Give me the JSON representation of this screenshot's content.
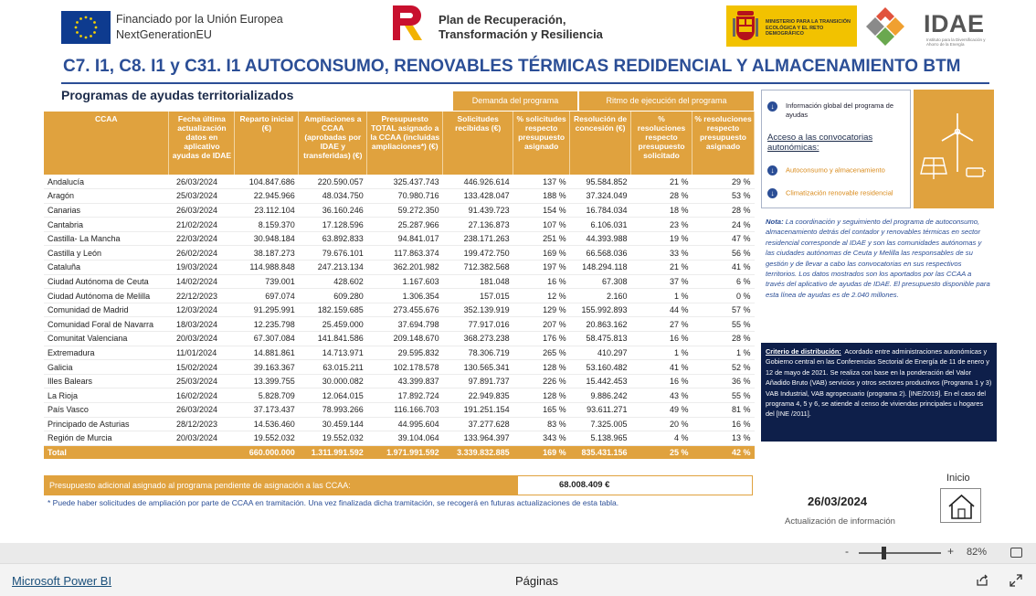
{
  "header": {
    "eu_line1": "Financiado por la Unión Europea",
    "eu_line2": "NextGenerationEU",
    "prtr_line1": "Plan de Recuperación,",
    "prtr_line2": "Transformación y Resiliencia",
    "ministerio": "MINISTERIO PARA LA TRANSICIÓN ECOLÓGICA Y EL RETO DEMOGRÁFICO",
    "idae": "IDAE",
    "idae_sub": "Instituto para la Diversificación y Ahorro de la Energía"
  },
  "title": "C7. I1, C8. I1 y C31. I1 AUTOCONSUMO, RENOVABLES TÉRMICAS REDIDENCIAL Y ALMACENAMIENTO BTM",
  "subtitle": "Programas de ayudas territorializados",
  "table": {
    "group_demanda": "Demanda del programa",
    "group_ritmo": "Ritmo de ejecución del programa",
    "columns": [
      "CCAA",
      "Fecha última actualización datos en aplicativo ayudas de IDAE",
      "Reparto inicial (€)",
      "Ampliaciones a CCAA (aprobadas por IDAE y transferidas) (€)",
      "Presupuesto TOTAL asignado a la CCAA (incluidas ampliaciones*) (€)",
      "Solicitudes recibidas (€)",
      "% solicitudes respecto presupuesto asignado",
      "Resolución de concesión (€)",
      "% resoluciones respecto presupuesto solicitado",
      "% resoluciones respecto presupuesto asignado"
    ],
    "rows": [
      [
        "Andalucía",
        "26/03/2024",
        "104.847.686",
        "220.590.057",
        "325.437.743",
        "446.926.614",
        "137 %",
        "95.584.852",
        "21 %",
        "29 %"
      ],
      [
        "Aragón",
        "25/03/2024",
        "22.945.966",
        "48.034.750",
        "70.980.716",
        "133.428.047",
        "188 %",
        "37.324.049",
        "28 %",
        "53 %"
      ],
      [
        "Canarias",
        "26/03/2024",
        "23.112.104",
        "36.160.246",
        "59.272.350",
        "91.439.723",
        "154 %",
        "16.784.034",
        "18 %",
        "28 %"
      ],
      [
        "Cantabria",
        "21/02/2024",
        "8.159.370",
        "17.128.596",
        "25.287.966",
        "27.136.873",
        "107 %",
        "6.106.031",
        "23 %",
        "24 %"
      ],
      [
        "Castilla- La Mancha",
        "22/03/2024",
        "30.948.184",
        "63.892.833",
        "94.841.017",
        "238.171.263",
        "251 %",
        "44.393.988",
        "19 %",
        "47 %"
      ],
      [
        "Castilla y León",
        "26/02/2024",
        "38.187.273",
        "79.676.101",
        "117.863.374",
        "199.472.750",
        "169 %",
        "66.568.036",
        "33 %",
        "56 %"
      ],
      [
        "Cataluña",
        "19/03/2024",
        "114.988.848",
        "247.213.134",
        "362.201.982",
        "712.382.568",
        "197 %",
        "148.294.118",
        "21 %",
        "41 %"
      ],
      [
        "Ciudad Autónoma de Ceuta",
        "14/02/2024",
        "739.001",
        "428.602",
        "1.167.603",
        "181.048",
        "16 %",
        "67.308",
        "37 %",
        "6 %"
      ],
      [
        "Ciudad Autónoma de Melilla",
        "22/12/2023",
        "697.074",
        "609.280",
        "1.306.354",
        "157.015",
        "12 %",
        "2.160",
        "1 %",
        "0 %"
      ],
      [
        "Comunidad de Madrid",
        "12/03/2024",
        "91.295.991",
        "182.159.685",
        "273.455.676",
        "352.139.919",
        "129 %",
        "155.992.893",
        "44 %",
        "57 %"
      ],
      [
        "Comunidad Foral de Navarra",
        "18/03/2024",
        "12.235.798",
        "25.459.000",
        "37.694.798",
        "77.917.016",
        "207 %",
        "20.863.162",
        "27 %",
        "55 %"
      ],
      [
        "Comunitat Valenciana",
        "20/03/2024",
        "67.307.084",
        "141.841.586",
        "209.148.670",
        "368.273.238",
        "176 %",
        "58.475.813",
        "16 %",
        "28 %"
      ],
      [
        "Extremadura",
        "11/01/2024",
        "14.881.861",
        "14.713.971",
        "29.595.832",
        "78.306.719",
        "265 %",
        "410.297",
        "1 %",
        "1 %"
      ],
      [
        "Galicia",
        "15/02/2024",
        "39.163.367",
        "63.015.211",
        "102.178.578",
        "130.565.341",
        "128 %",
        "53.160.482",
        "41 %",
        "52 %"
      ],
      [
        "Illes Balears",
        "25/03/2024",
        "13.399.755",
        "30.000.082",
        "43.399.837",
        "97.891.737",
        "226 %",
        "15.442.453",
        "16 %",
        "36 %"
      ],
      [
        "La Rioja",
        "16/02/2024",
        "5.828.709",
        "12.064.015",
        "17.892.724",
        "22.949.835",
        "128 %",
        "9.886.242",
        "43 %",
        "55 %"
      ],
      [
        "País Vasco",
        "26/03/2024",
        "37.173.437",
        "78.993.266",
        "116.166.703",
        "191.251.154",
        "165 %",
        "93.611.271",
        "49 %",
        "81 %"
      ],
      [
        "Principado de Asturias",
        "28/12/2023",
        "14.536.460",
        "30.459.144",
        "44.995.604",
        "37.277.628",
        "83 %",
        "7.325.005",
        "20 %",
        "16 %"
      ],
      [
        "Región de Murcia",
        "20/03/2024",
        "19.552.032",
        "19.552.032",
        "39.104.064",
        "133.964.397",
        "343 %",
        "5.138.965",
        "4 %",
        "13 %"
      ]
    ],
    "total": [
      "Total",
      "",
      "660.000.000",
      "1.311.991.592",
      "1.971.991.592",
      "3.339.832.885",
      "169 %",
      "835.431.156",
      "25 %",
      "42 %"
    ]
  },
  "adicional": {
    "label": "Presupuesto adicional asignado al programa pendiente de asignación a las CCAA:",
    "value": "68.008.409 €"
  },
  "footnote": "* Puede haber solicitudes de ampliación por parte de CCAA en tramitación. Una vez finalizada dicha tramitación, se recogerá en futuras actualizaciones de esta tabla.",
  "info": {
    "global": "Información global del programa de ayudas",
    "acceso": "Acceso a las convocatorias autonómicas:",
    "link1": "Autoconsumo y almacenamiento",
    "link2": "Climatización renovable residencial"
  },
  "nota_label": "Nota:",
  "nota": "La coordinación y seguimiento del programa de autoconsumo, almacenamiento detrás del contador y renovables térmicas en sector residencial corresponde al IDAE y son las comunidades autónomas y las ciudades autónomas de Ceuta y Melilla las responsables de su gestión y de llevar a cabo las convocatorias en sus respectivos territorios. Los datos mostrados son los aportados por las CCAA a través del aplicativo de ayudas de IDAE. El presupuesto disponible para esta línea de ayudas es de 2.040 millones.",
  "criterio_label": "Criterio de distribución:",
  "criterio": "Acordado entre administraciones autonómicas y Gobierno central en las Conferencias Sectorial de Energía de 11 de enero y 12 de mayo de 2021. Se realiza con base en la ponderación del Valor Añadido Bruto (VAB) servicios y otros sectores productivos (Programa 1 y 3) VAB Industrial, VAB agropecuario (programa 2). [INE/2019]. En el caso del programa 4, 5 y 6, se atiende al censo de viviendas principales u hogares del [INE /2011].",
  "inicio": "Inicio",
  "update_date": "26/03/2024",
  "update_label": "Actualización de información",
  "chrome": {
    "zoom_minus": "-",
    "zoom_plus": "+",
    "zoom_pct": "82%",
    "zoom_level": 0.3,
    "pbi_link": "Microsoft Power BI",
    "paginas": "Páginas"
  },
  "colors": {
    "accent": "#e0a23e",
    "title_blue": "#2b4e96",
    "navy": "#0e1f4a"
  }
}
